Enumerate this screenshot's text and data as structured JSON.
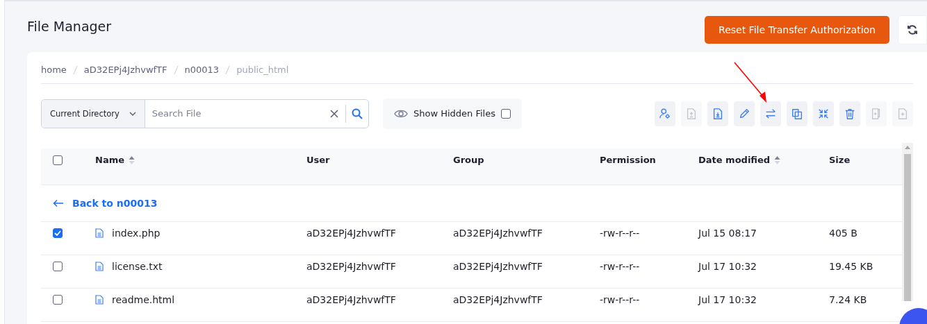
{
  "title": "File Manager",
  "reset_button": "Reset File Transfer Authorization",
  "breadcrumb": [
    {
      "label": "home",
      "current": false
    },
    {
      "label": "aD32EPj4JzhvwfTF",
      "current": false
    },
    {
      "label": "n00013",
      "current": false
    },
    {
      "label": "public_html",
      "current": true
    }
  ],
  "search": {
    "scope": "Current Directory",
    "placeholder": "Search File"
  },
  "hidden_files": {
    "label": "Show Hidden Files",
    "checked": false
  },
  "toolbar": [
    {
      "kind": "owner",
      "disabled": false
    },
    {
      "kind": "upload",
      "disabled": true
    },
    {
      "kind": "download",
      "disabled": false
    },
    {
      "kind": "rename",
      "disabled": false
    },
    {
      "kind": "move",
      "disabled": false
    },
    {
      "kind": "copy",
      "disabled": false
    },
    {
      "kind": "compress",
      "disabled": false
    },
    {
      "kind": "delete",
      "disabled": false
    },
    {
      "kind": "new-folder",
      "disabled": true
    },
    {
      "kind": "new-file",
      "disabled": true
    }
  ],
  "table": {
    "all_checked": false,
    "columns": [
      {
        "label": "Name",
        "sortable": true
      },
      {
        "label": "User",
        "sortable": false
      },
      {
        "label": "Group",
        "sortable": false
      },
      {
        "label": "Permission",
        "sortable": false
      },
      {
        "label": "Date modified",
        "sortable": true
      },
      {
        "label": "Size",
        "sortable": false
      }
    ],
    "back_link": "Back to n00013",
    "rows": [
      {
        "name": "index.php",
        "user": "aD32EPj4JzhvwfTF",
        "group": "aD32EPj4JzhvwfTF",
        "permission": "-rw-r--r--",
        "date": "Jul 15 08:17",
        "size": "405 B",
        "selected": true
      },
      {
        "name": "license.txt",
        "user": "aD32EPj4JzhvwfTF",
        "group": "aD32EPj4JzhvwfTF",
        "permission": "-rw-r--r--",
        "date": "Jul 17 10:32",
        "size": "19.45 KB",
        "selected": false
      },
      {
        "name": "readme.html",
        "user": "aD32EPj4JzhvwfTF",
        "group": "aD32EPj4JzhvwfTF",
        "permission": "-rw-r--r--",
        "date": "Jul 17 10:32",
        "size": "7.24 KB",
        "selected": false
      }
    ]
  }
}
